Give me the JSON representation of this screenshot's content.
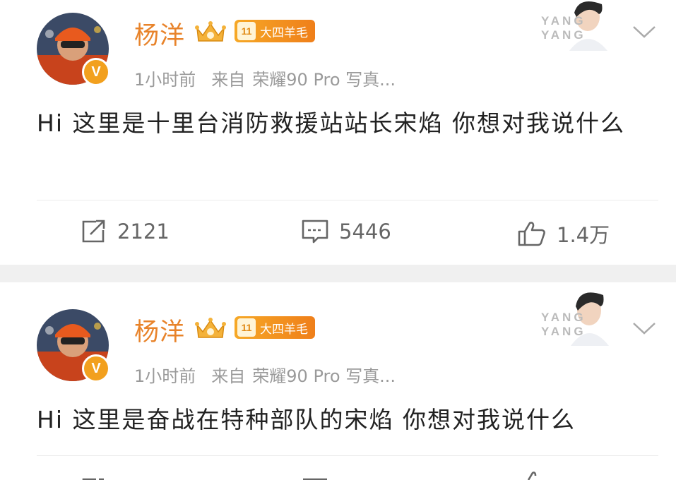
{
  "posts": [
    {
      "author": "杨洋",
      "level_badge": "11",
      "level_title": "大四羊毛",
      "time": "1小时前",
      "from_label": "来自",
      "device": "荣耀90 Pro 写真...",
      "thumbnail_text": "YANG YANG",
      "text": "Hi 这里是十里台消防救援站站长宋焰 你想对我说什么",
      "reposts": "2121",
      "comments": "5446",
      "likes": "1.4万"
    },
    {
      "author": "杨洋",
      "level_badge": "11",
      "level_title": "大四羊毛",
      "time": "1小时前",
      "from_label": "来自",
      "device": "荣耀90 Pro 写真...",
      "thumbnail_text": "YANG YANG",
      "text": "Hi 这里是奋战在特种部队的宋焰 你想对我说什么"
    }
  ],
  "icons": {
    "verified": "V",
    "crown": "crown-icon",
    "more": "chevron-down-icon",
    "repost": "share-icon",
    "comment": "comment-icon",
    "like": "thumbs-up-icon"
  },
  "colors": {
    "name": "#e8832a",
    "badge": "#f2a01e",
    "meta": "#9a9a9a",
    "text": "#222222"
  }
}
